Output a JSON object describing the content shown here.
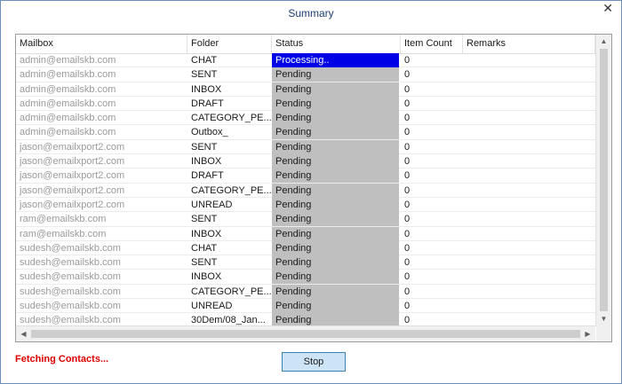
{
  "window": {
    "title": "Summary",
    "close_glyph": "✕"
  },
  "table": {
    "columns": [
      "Mailbox",
      "Folder",
      "Status",
      "Item Count",
      "Remarks"
    ],
    "rows": [
      {
        "mailbox": "admin@emailskb.com",
        "folder": "CHAT",
        "status": "Processing..",
        "count": "0",
        "remarks": "",
        "active": true
      },
      {
        "mailbox": "admin@emailskb.com",
        "folder": "SENT",
        "status": "Pending",
        "count": "0",
        "remarks": ""
      },
      {
        "mailbox": "admin@emailskb.com",
        "folder": "INBOX",
        "status": "Pending",
        "count": "0",
        "remarks": ""
      },
      {
        "mailbox": "admin@emailskb.com",
        "folder": "DRAFT",
        "status": "Pending",
        "count": "0",
        "remarks": ""
      },
      {
        "mailbox": "admin@emailskb.com",
        "folder": "CATEGORY_PE...",
        "status": "Pending",
        "count": "0",
        "remarks": ""
      },
      {
        "mailbox": "admin@emailskb.com",
        "folder": "Outbox_",
        "status": "Pending",
        "count": "0",
        "remarks": ""
      },
      {
        "mailbox": "jason@emailxport2.com",
        "folder": "SENT",
        "status": "Pending",
        "count": "0",
        "remarks": ""
      },
      {
        "mailbox": "jason@emailxport2.com",
        "folder": "INBOX",
        "status": "Pending",
        "count": "0",
        "remarks": ""
      },
      {
        "mailbox": "jason@emailxport2.com",
        "folder": "DRAFT",
        "status": "Pending",
        "count": "0",
        "remarks": ""
      },
      {
        "mailbox": "jason@emailxport2.com",
        "folder": "CATEGORY_PE...",
        "status": "Pending",
        "count": "0",
        "remarks": ""
      },
      {
        "mailbox": "jason@emailxport2.com",
        "folder": "UNREAD",
        "status": "Pending",
        "count": "0",
        "remarks": ""
      },
      {
        "mailbox": "ram@emailskb.com",
        "folder": "SENT",
        "status": "Pending",
        "count": "0",
        "remarks": ""
      },
      {
        "mailbox": "ram@emailskb.com",
        "folder": "INBOX",
        "status": "Pending",
        "count": "0",
        "remarks": ""
      },
      {
        "mailbox": "sudesh@emailskb.com",
        "folder": "CHAT",
        "status": "Pending",
        "count": "0",
        "remarks": ""
      },
      {
        "mailbox": "sudesh@emailskb.com",
        "folder": "SENT",
        "status": "Pending",
        "count": "0",
        "remarks": ""
      },
      {
        "mailbox": "sudesh@emailskb.com",
        "folder": "INBOX",
        "status": "Pending",
        "count": "0",
        "remarks": ""
      },
      {
        "mailbox": "sudesh@emailskb.com",
        "folder": "CATEGORY_PE...",
        "status": "Pending",
        "count": "0",
        "remarks": ""
      },
      {
        "mailbox": "sudesh@emailskb.com",
        "folder": "UNREAD",
        "status": "Pending",
        "count": "0",
        "remarks": ""
      },
      {
        "mailbox": "sudesh@emailskb.com",
        "folder": "30Dem/08_Jan...",
        "status": "Pending",
        "count": "0",
        "remarks": ""
      }
    ]
  },
  "footer": {
    "status_text": "Fetching Contacts...",
    "stop_label": "Stop"
  },
  "colors": {
    "active_status": "#0000e6",
    "pending_status": "#bfbfbf",
    "status_text": "#e00000",
    "button_bg": "#cde4f7"
  }
}
